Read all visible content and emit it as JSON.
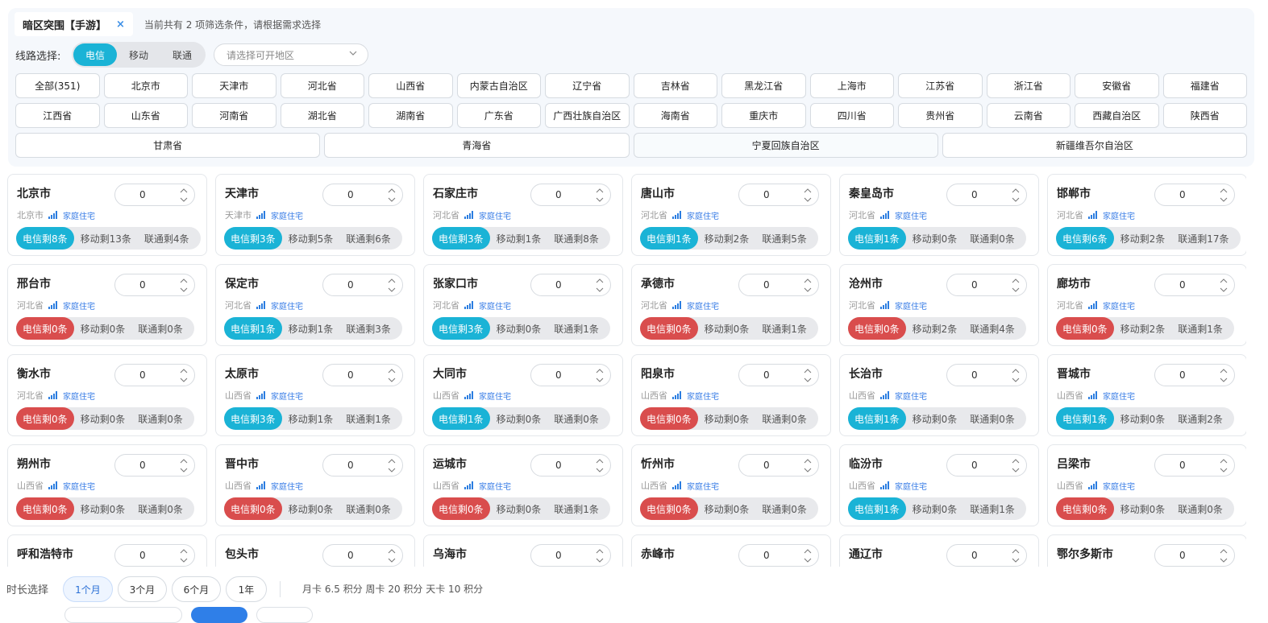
{
  "filter": {
    "game_tag": "暗区突围【手游】",
    "close_glyph": "×",
    "hint": "当前共有 2 项筛选条件，请根据需求选择",
    "line_label": "线路选择:",
    "lines": [
      "电信",
      "移动",
      "联通"
    ],
    "active_line": "电信",
    "region_placeholder": "请选择可开地区"
  },
  "provinces": {
    "row1": [
      "全部(351)",
      "北京市",
      "天津市",
      "河北省",
      "山西省",
      "内蒙古自治区",
      "辽宁省",
      "吉林省",
      "黑龙江省",
      "上海市",
      "江苏省",
      "浙江省",
      "安徽省",
      "福建省"
    ],
    "row2": [
      "江西省",
      "山东省",
      "河南省",
      "湖北省",
      "湖南省",
      "广东省",
      "广西壮族自治区",
      "海南省",
      "重庆市",
      "四川省",
      "贵州省",
      "云南省",
      "西藏自治区",
      "陕西省"
    ],
    "row3": [
      "甘肃省",
      "青海省",
      "宁夏回族自治区",
      "新疆维吾尔自治区"
    ]
  },
  "home_tag": "家庭住宅",
  "cities": [
    {
      "name": "北京市",
      "prov": "北京市",
      "qty": "0",
      "tele": "电信剩8条",
      "mobile": "移动剩13条",
      "unicom": "联通剩4条",
      "status": "ok"
    },
    {
      "name": "天津市",
      "prov": "天津市",
      "qty": "0",
      "tele": "电信剩3条",
      "mobile": "移动剩5条",
      "unicom": "联通剩6条",
      "status": "ok"
    },
    {
      "name": "石家庄市",
      "prov": "河北省",
      "qty": "0",
      "tele": "电信剩3条",
      "mobile": "移动剩1条",
      "unicom": "联通剩8条",
      "status": "ok"
    },
    {
      "name": "唐山市",
      "prov": "河北省",
      "qty": "0",
      "tele": "电信剩1条",
      "mobile": "移动剩2条",
      "unicom": "联通剩5条",
      "status": "ok"
    },
    {
      "name": "秦皇岛市",
      "prov": "河北省",
      "qty": "0",
      "tele": "电信剩1条",
      "mobile": "移动剩0条",
      "unicom": "联通剩0条",
      "status": "ok"
    },
    {
      "name": "邯郸市",
      "prov": "河北省",
      "qty": "0",
      "tele": "电信剩6条",
      "mobile": "移动剩2条",
      "unicom": "联通剩17条",
      "status": "ok"
    },
    {
      "name": "邢台市",
      "prov": "河北省",
      "qty": "0",
      "tele": "电信剩0条",
      "mobile": "移动剩0条",
      "unicom": "联通剩0条",
      "status": "empty"
    },
    {
      "name": "保定市",
      "prov": "河北省",
      "qty": "0",
      "tele": "电信剩1条",
      "mobile": "移动剩1条",
      "unicom": "联通剩3条",
      "status": "ok"
    },
    {
      "name": "张家口市",
      "prov": "河北省",
      "qty": "0",
      "tele": "电信剩3条",
      "mobile": "移动剩0条",
      "unicom": "联通剩1条",
      "status": "ok"
    },
    {
      "name": "承德市",
      "prov": "河北省",
      "qty": "0",
      "tele": "电信剩0条",
      "mobile": "移动剩0条",
      "unicom": "联通剩1条",
      "status": "empty"
    },
    {
      "name": "沧州市",
      "prov": "河北省",
      "qty": "0",
      "tele": "电信剩0条",
      "mobile": "移动剩2条",
      "unicom": "联通剩4条",
      "status": "empty"
    },
    {
      "name": "廊坊市",
      "prov": "河北省",
      "qty": "0",
      "tele": "电信剩0条",
      "mobile": "移动剩2条",
      "unicom": "联通剩1条",
      "status": "empty"
    },
    {
      "name": "衡水市",
      "prov": "河北省",
      "qty": "0",
      "tele": "电信剩0条",
      "mobile": "移动剩0条",
      "unicom": "联通剩0条",
      "status": "empty"
    },
    {
      "name": "太原市",
      "prov": "山西省",
      "qty": "0",
      "tele": "电信剩3条",
      "mobile": "移动剩1条",
      "unicom": "联通剩1条",
      "status": "ok"
    },
    {
      "name": "大同市",
      "prov": "山西省",
      "qty": "0",
      "tele": "电信剩1条",
      "mobile": "移动剩0条",
      "unicom": "联通剩0条",
      "status": "ok"
    },
    {
      "name": "阳泉市",
      "prov": "山西省",
      "qty": "0",
      "tele": "电信剩0条",
      "mobile": "移动剩0条",
      "unicom": "联通剩0条",
      "status": "empty"
    },
    {
      "name": "长治市",
      "prov": "山西省",
      "qty": "0",
      "tele": "电信剩1条",
      "mobile": "移动剩0条",
      "unicom": "联通剩0条",
      "status": "ok"
    },
    {
      "name": "晋城市",
      "prov": "山西省",
      "qty": "0",
      "tele": "电信剩1条",
      "mobile": "移动剩0条",
      "unicom": "联通剩2条",
      "status": "ok"
    },
    {
      "name": "朔州市",
      "prov": "山西省",
      "qty": "0",
      "tele": "电信剩0条",
      "mobile": "移动剩0条",
      "unicom": "联通剩0条",
      "status": "empty"
    },
    {
      "name": "晋中市",
      "prov": "山西省",
      "qty": "0",
      "tele": "电信剩0条",
      "mobile": "移动剩0条",
      "unicom": "联通剩0条",
      "status": "empty"
    },
    {
      "name": "运城市",
      "prov": "山西省",
      "qty": "0",
      "tele": "电信剩0条",
      "mobile": "移动剩0条",
      "unicom": "联通剩1条",
      "status": "empty"
    },
    {
      "name": "忻州市",
      "prov": "山西省",
      "qty": "0",
      "tele": "电信剩0条",
      "mobile": "移动剩0条",
      "unicom": "联通剩0条",
      "status": "empty"
    },
    {
      "name": "临汾市",
      "prov": "山西省",
      "qty": "0",
      "tele": "电信剩1条",
      "mobile": "移动剩0条",
      "unicom": "联通剩1条",
      "status": "ok"
    },
    {
      "name": "吕梁市",
      "prov": "山西省",
      "qty": "0",
      "tele": "电信剩0条",
      "mobile": "移动剩0条",
      "unicom": "联通剩0条",
      "status": "empty"
    },
    {
      "name": "呼和浩特市",
      "prov": "",
      "qty": "0",
      "tele": "",
      "mobile": "",
      "unicom": "",
      "status": "ok"
    },
    {
      "name": "包头市",
      "prov": "",
      "qty": "0",
      "tele": "",
      "mobile": "",
      "unicom": "",
      "status": "ok"
    },
    {
      "name": "乌海市",
      "prov": "",
      "qty": "0",
      "tele": "",
      "mobile": "",
      "unicom": "",
      "status": "ok"
    },
    {
      "name": "赤峰市",
      "prov": "",
      "qty": "0",
      "tele": "",
      "mobile": "",
      "unicom": "",
      "status": "ok"
    },
    {
      "name": "通辽市",
      "prov": "",
      "qty": "0",
      "tele": "",
      "mobile": "",
      "unicom": "",
      "status": "ok"
    },
    {
      "name": "鄂尔多斯市",
      "prov": "",
      "qty": "0",
      "tele": "",
      "mobile": "",
      "unicom": "",
      "status": "ok"
    }
  ],
  "bottom": {
    "duration_label": "时长选择",
    "durations": [
      "1个月",
      "3个月",
      "6个月",
      "1年"
    ],
    "active_duration": "1个月",
    "price_text": "月卡 6.5 积分 周卡 20 积分 天卡 10 积分"
  },
  "colors": {
    "accent": "#1ab3d6",
    "danger": "#d94d4d",
    "link": "#3a7ee6"
  }
}
